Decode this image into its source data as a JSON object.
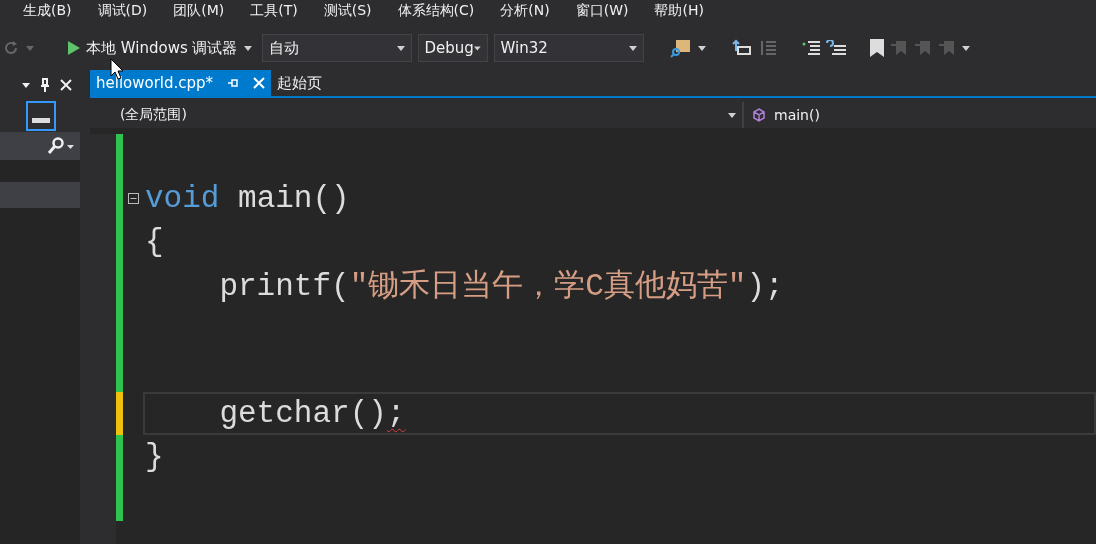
{
  "menu": [
    "生成(B)",
    "调试(D)",
    "团队(M)",
    "工具(T)",
    "测试(S)",
    "体系结构(C)",
    "分析(N)",
    "窗口(W)",
    "帮助(H)"
  ],
  "toolbar": {
    "debugger": "本地 Windows 调试器",
    "combos": [
      {
        "value": "自动",
        "wide": true
      },
      {
        "value": "Debug",
        "wide": false
      },
      {
        "value": "Win32",
        "wide": true
      }
    ]
  },
  "tabs": [
    {
      "label": "helloworld.cpp*",
      "selected": true
    },
    {
      "label": "起始页",
      "selected": false
    }
  ],
  "nav": {
    "scope": "(全局范围)",
    "member": "main()"
  },
  "code": [
    {
      "unsaved": false,
      "current": false
    },
    {
      "unsaved": false,
      "current": false,
      "expanded": true,
      "segments": [
        {
          "kind": "keyword",
          "text": "void"
        },
        {
          "kind": "plain",
          "text": " main()"
        }
      ]
    },
    {
      "unsaved": false,
      "current": false,
      "segments": [
        {
          "kind": "plain",
          "text": "{"
        }
      ]
    },
    {
      "unsaved": false,
      "current": false,
      "segments": [
        {
          "kind": "plain",
          "text": "    printf("
        },
        {
          "kind": "string",
          "text": "″锄禾日当午，学C真他妈苦″"
        },
        {
          "kind": "plain",
          "text": ");"
        }
      ]
    },
    {
      "unsaved": false,
      "current": false
    },
    {
      "unsaved": false,
      "current": false
    },
    {
      "unsaved": true,
      "current": true,
      "segments": [
        {
          "kind": "plain",
          "text": "    getchar()"
        },
        {
          "kind": "plain",
          "text": ";",
          "error": true
        }
      ]
    },
    {
      "unsaved": false,
      "current": false,
      "segments": [
        {
          "kind": "plain",
          "text": "}"
        }
      ]
    },
    {
      "unsaved": false,
      "current": false
    }
  ]
}
